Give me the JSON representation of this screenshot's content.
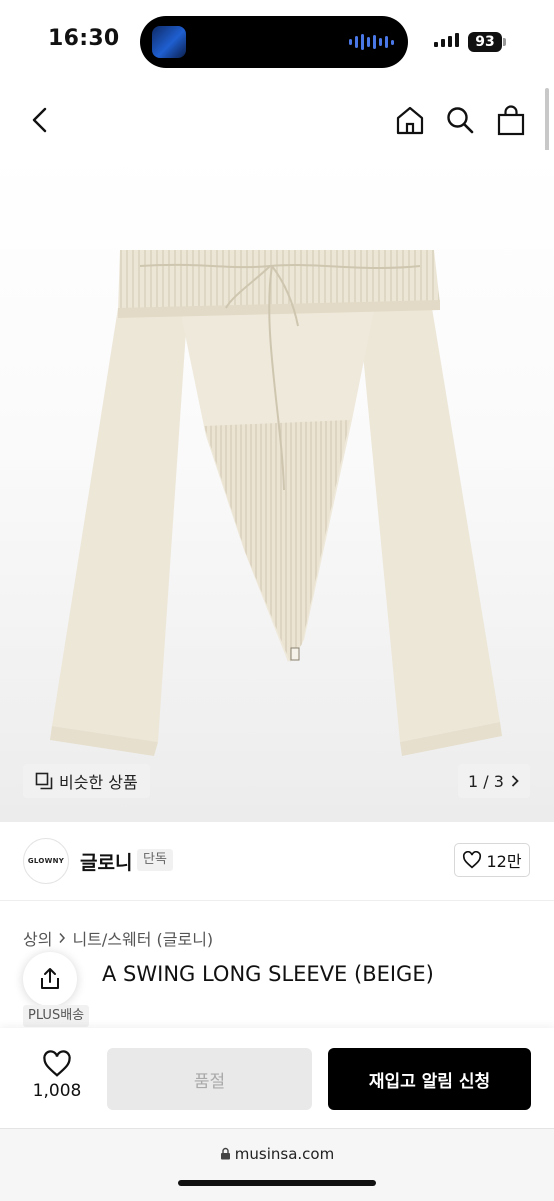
{
  "status_bar": {
    "time": "16:30",
    "battery": "93"
  },
  "nav": {
    "back": "back-icon",
    "home": "home-icon",
    "search": "search-icon",
    "cart": "shopping-bag-icon"
  },
  "gallery": {
    "similar_label": "비슷한 상품",
    "pager": "1 / 3"
  },
  "brand": {
    "logo_text": "GLOWNY",
    "name": "글로니",
    "exclusive_badge": "단독",
    "likes": "12만"
  },
  "breadcrumb": {
    "level1": "상의",
    "level2": "니트/스웨터 (글로니)"
  },
  "product": {
    "title": "A SWING LONG SLEEVE (BEIGE)",
    "shipping_badge": "PLUS배송"
  },
  "bottom_bar": {
    "wish_count": "1,008",
    "soldout_label": "품절",
    "restock_label": "재입고 알림 신청"
  },
  "browser": {
    "url": "musinsa.com"
  },
  "colors": {
    "accent": "#000000",
    "garment": "#ece6d6",
    "soldout_bg": "#e9e9e9"
  }
}
